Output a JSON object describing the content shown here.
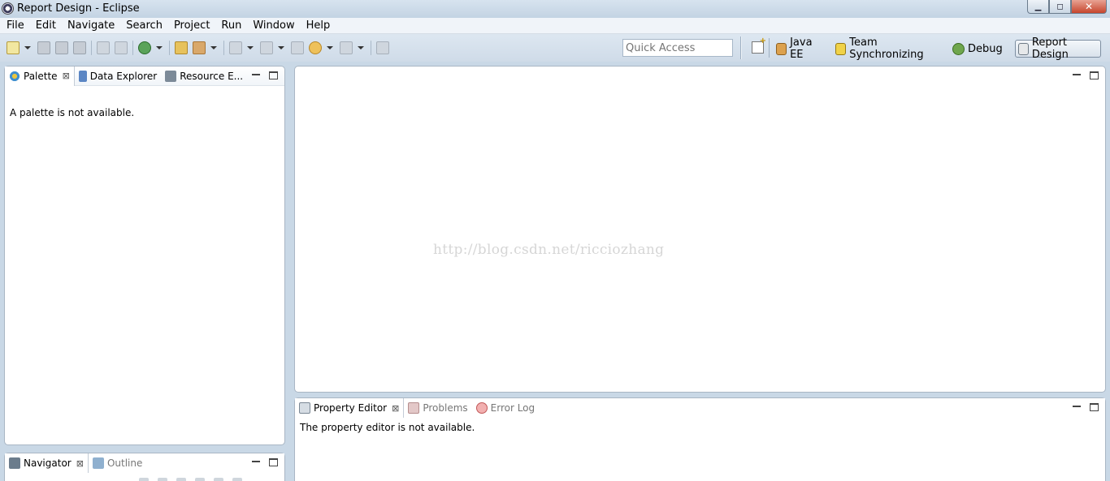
{
  "window": {
    "title": "Report Design - Eclipse",
    "minimize_label": "▁",
    "maximize_label": "◻",
    "close_label": "✕"
  },
  "menu": [
    "File",
    "Edit",
    "Navigate",
    "Search",
    "Project",
    "Run",
    "Window",
    "Help"
  ],
  "toolbar": {
    "quick_access_placeholder": "Quick Access"
  },
  "perspectives": [
    {
      "label": "Java EE",
      "icon": "java-ee-icon",
      "active": false
    },
    {
      "label": "Team Synchronizing",
      "icon": "team-sync-icon",
      "active": false
    },
    {
      "label": "Debug",
      "icon": "debug-bug-icon",
      "active": false
    },
    {
      "label": "Report Design",
      "icon": "report-design-icon",
      "active": true
    }
  ],
  "left_top": {
    "tabs": [
      {
        "label": "Palette",
        "icon": "palette-icon",
        "close": "⊠"
      },
      {
        "label": "Data Explorer",
        "icon": "data-explorer-icon"
      },
      {
        "label": "Resource E...",
        "icon": "resource-explorer-icon"
      }
    ],
    "message": "A palette is not available."
  },
  "left_bottom": {
    "tabs": [
      {
        "label": "Navigator",
        "icon": "navigator-icon",
        "close": "⊠"
      },
      {
        "label": "Outline",
        "icon": "outline-icon"
      }
    ]
  },
  "editor": {
    "watermark": "http://blog.csdn.net/ricciozhang"
  },
  "bottom": {
    "tabs": [
      {
        "label": "Property Editor",
        "icon": "property-editor-icon",
        "close": "⊠"
      },
      {
        "label": "Problems",
        "icon": "problems-icon"
      },
      {
        "label": "Error Log",
        "icon": "error-log-icon"
      }
    ],
    "message": "The property editor is not available."
  }
}
